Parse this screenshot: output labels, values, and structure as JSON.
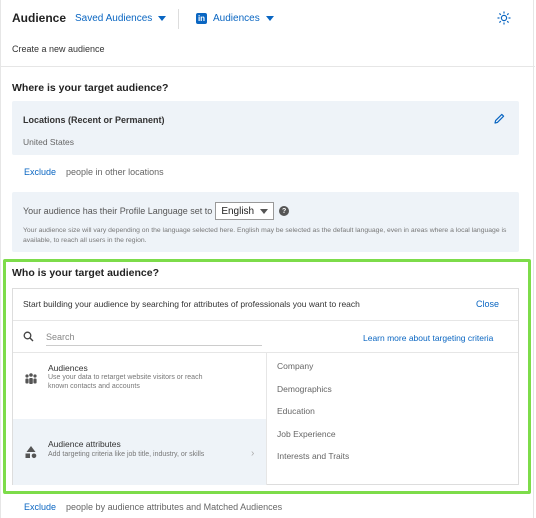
{
  "header": {
    "title": "Audience",
    "saved_audiences_label": "Saved Audiences",
    "audiences_label": "Audiences",
    "network_icon": "linkedin-icon",
    "tips_icon": "lightbulb-icon"
  },
  "subheader": "Create a new audience",
  "where": {
    "title": "Where is your target audience?",
    "locations_label": "Locations (Recent or Permanent)",
    "locations_value": "United States",
    "edit_icon": "pencil-icon",
    "exclude_link": "Exclude",
    "exclude_text": "people in other locations"
  },
  "language": {
    "prefix": "Your audience has their Profile Language set to",
    "selected": "English",
    "note": "Your audience size will vary depending on the language selected here. English may be selected as the default language, even in areas where a local language is available, to reach all users in the region."
  },
  "who": {
    "title": "Who is your target audience?",
    "prompt": "Start building your audience by searching for attributes of professionals you want to reach",
    "close_label": "Close",
    "search_placeholder": "Search",
    "learn_more": "Learn more about targeting criteria",
    "categories": [
      {
        "title": "Audiences",
        "desc": "Use your data to retarget website visitors or reach known contacts and accounts",
        "icon": "people-icon"
      },
      {
        "title": "Audience attributes",
        "desc": "Add targeting criteria like job title, industry, or skills",
        "icon": "shapes-icon"
      }
    ],
    "options": [
      "Company",
      "Demographics",
      "Education",
      "Job Experience",
      "Interests and Traits"
    ],
    "exclude_link": "Exclude",
    "exclude_text": "people by audience attributes and Matched Audiences"
  },
  "colors": {
    "accent": "#0a66c2",
    "highlight": "#7ddc4a",
    "panel_bg": "#eef3f8"
  }
}
